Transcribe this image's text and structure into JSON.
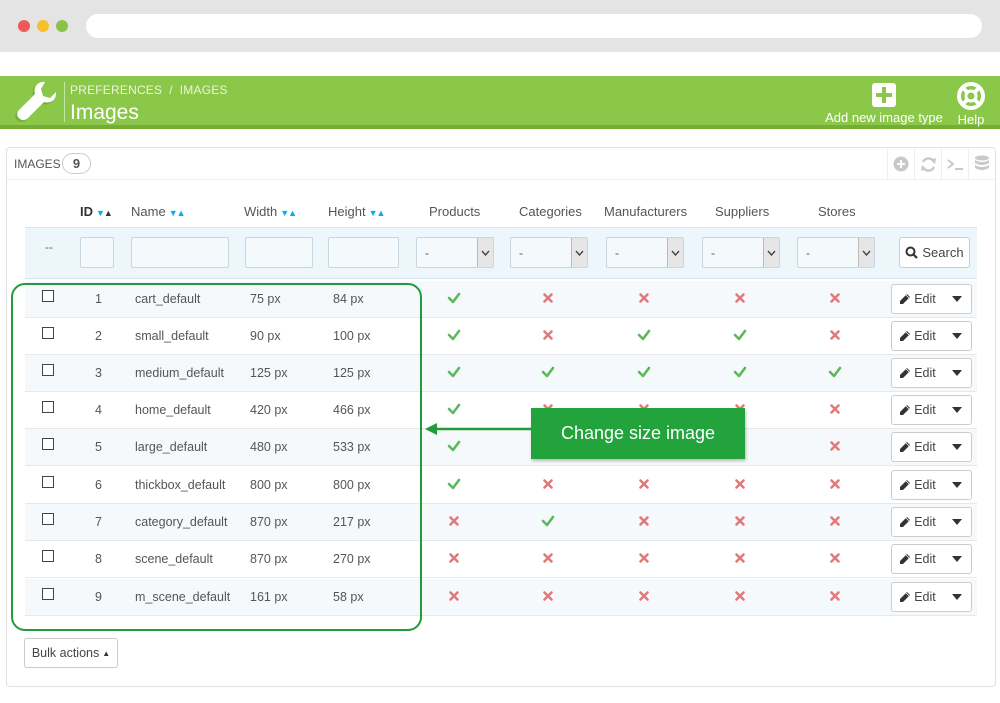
{
  "header": {
    "breadcrumb": [
      "PREFERENCES",
      "IMAGES"
    ],
    "breadcrumb_sep": "/",
    "title": "Images",
    "add_label": "Add new image type",
    "help_label": "Help",
    "accent_color": "#8bc84a"
  },
  "panel": {
    "title": "IMAGES",
    "count": "9",
    "tool_icons": [
      "add-circle-icon",
      "refresh-icon",
      "terminal-icon",
      "database-icon"
    ]
  },
  "table": {
    "columns": {
      "id": "ID",
      "name": "Name",
      "width": "Width",
      "height": "Height",
      "products": "Products",
      "categories": "Categories",
      "manufacturers": "Manufacturers",
      "suppliers": "Suppliers",
      "stores": "Stores"
    },
    "filter": {
      "dash": "--",
      "select_value": "-",
      "search_label": "Search"
    },
    "edit_label": "Edit",
    "rows": [
      {
        "id": "1",
        "name": "cart_default",
        "width": "75 px",
        "height": "84 px",
        "flags": [
          true,
          false,
          false,
          false,
          false
        ]
      },
      {
        "id": "2",
        "name": "small_default",
        "width": "90 px",
        "height": "100 px",
        "flags": [
          true,
          false,
          true,
          true,
          false
        ]
      },
      {
        "id": "3",
        "name": "medium_default",
        "width": "125 px",
        "height": "125 px",
        "flags": [
          true,
          true,
          true,
          true,
          true
        ]
      },
      {
        "id": "4",
        "name": "home_default",
        "width": "420 px",
        "height": "466 px",
        "flags": [
          true,
          false,
          false,
          false,
          false
        ]
      },
      {
        "id": "5",
        "name": "large_default",
        "width": "480 px",
        "height": "533 px",
        "flags": [
          true,
          false,
          false,
          false,
          false
        ]
      },
      {
        "id": "6",
        "name": "thickbox_default",
        "width": "800 px",
        "height": "800 px",
        "flags": [
          true,
          false,
          false,
          false,
          false
        ]
      },
      {
        "id": "7",
        "name": "category_default",
        "width": "870 px",
        "height": "217 px",
        "flags": [
          false,
          true,
          false,
          false,
          false
        ]
      },
      {
        "id": "8",
        "name": "scene_default",
        "width": "870 px",
        "height": "270 px",
        "flags": [
          false,
          false,
          false,
          false,
          false
        ]
      },
      {
        "id": "9",
        "name": "m_scene_default",
        "width": "161 px",
        "height": "58 px",
        "flags": [
          false,
          false,
          false,
          false,
          false
        ]
      }
    ]
  },
  "callout": {
    "text": "Change size image",
    "color": "#23a33b"
  },
  "bulk_actions_label": "Bulk actions",
  "status_colors": {
    "check": "#5cb85c",
    "cross": "#e07b7b"
  }
}
